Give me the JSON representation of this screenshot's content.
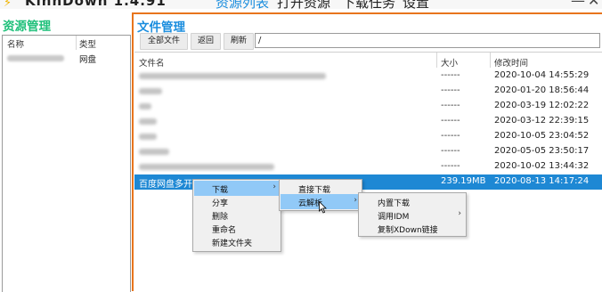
{
  "app": {
    "title": "KinhDown 1.4.91",
    "logo_glyph": "⚡",
    "nav_tabs": [
      "资源列表",
      "打开资源",
      "下载任务",
      "设置"
    ],
    "active_tab": "资源列表",
    "minimize_glyph": "—",
    "close_glyph": "✕"
  },
  "left_panel": {
    "title": "资源管理",
    "col_name": "名称",
    "col_type": "类型",
    "items": [
      {
        "type": "网盘"
      }
    ]
  },
  "right_panel": {
    "title": "文件管理",
    "toolbar": {
      "all_files_label": "全部文件",
      "back_label": "返回",
      "refresh_label": "刷新",
      "path_value": "/"
    },
    "list": {
      "col_name": "文件名",
      "col_size": "大小",
      "col_modified": "修改时间",
      "rows": [
        {
          "name": "",
          "size": "------",
          "modified": "2020-10-04 14:55:29"
        },
        {
          "name": "",
          "size": "------",
          "modified": "2020-01-20 18:56:44"
        },
        {
          "name": "",
          "size": "------",
          "modified": "2020-03-19 12:02:22"
        },
        {
          "name": "",
          "size": "------",
          "modified": "2020-03-12 22:39:15"
        },
        {
          "name": "",
          "size": "------",
          "modified": "2020-10-05 23:04:52"
        },
        {
          "name": "",
          "size": "------",
          "modified": "2020-05-05 23:50:17"
        },
        {
          "name": "",
          "size": "------",
          "modified": "2020-10-02 13:44:32"
        },
        {
          "name": "百度网盘多开.rar",
          "size": "239.19MB",
          "modified": "2020-08-13 14:17:24"
        }
      ]
    }
  },
  "context_menu": {
    "items": [
      "下载",
      "分享",
      "删除",
      "重命名",
      "新建文件夹"
    ],
    "submenu_download": [
      "直接下载",
      "云解析"
    ],
    "submenu_cloud": [
      "内置下载",
      "调用IDM",
      "复制XDown链接"
    ],
    "arrow_glyph": "›"
  }
}
